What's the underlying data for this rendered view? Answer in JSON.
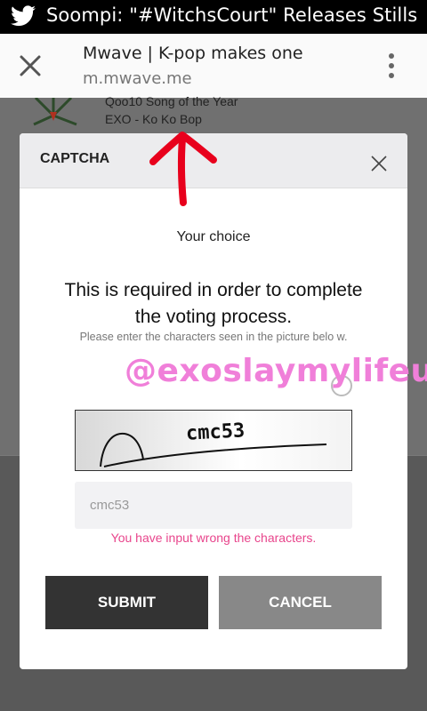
{
  "status_bar": {
    "text": "Soompi: \"#WitchsCourt\" Releases Stills",
    "icon": "twitter-bird-icon"
  },
  "toolbar": {
    "title": "Mwave | K-pop makes one",
    "url": "m.mwave.me",
    "close_icon": "close-icon",
    "menu_icon": "more-vert-icon"
  },
  "background_page": {
    "line1": "Qoo10 Song of the Year",
    "line2": "EXO - Ko Ko Bop"
  },
  "modal": {
    "title": "CAPTCHA",
    "choice_label": "Your choice",
    "required_text": "This is required in order to complete the voting process.",
    "instruction": "Please enter the characters seen in the picture belo w.",
    "captcha_text": "cmc53",
    "input_value": "cmc53",
    "error": "You have input wrong the characters.",
    "submit_label": "SUBMIT",
    "cancel_label": "CANCEL"
  },
  "watermark": "@exoslaymylifeu",
  "colors": {
    "error": "#e8458c",
    "watermark": "#f07fd9",
    "arrow": "#e8001c"
  }
}
